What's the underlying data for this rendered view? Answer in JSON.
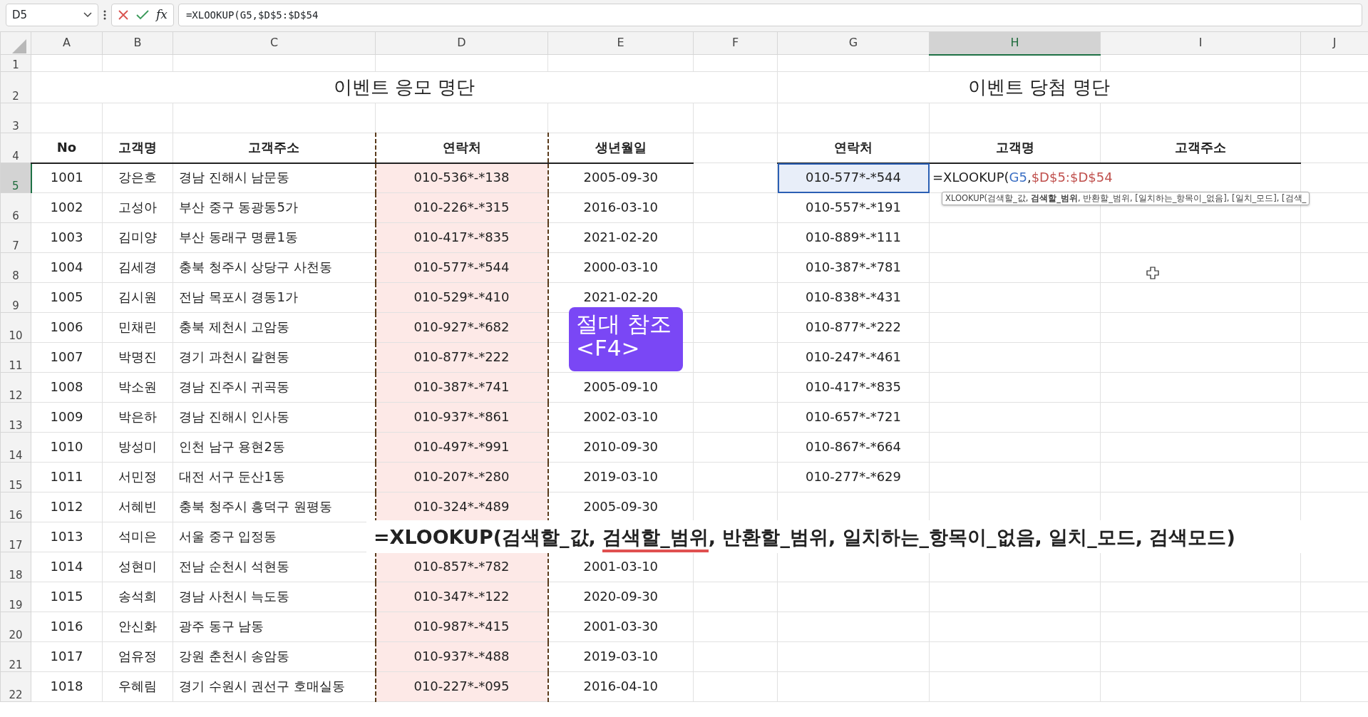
{
  "name_box": "D5",
  "formula_bar": {
    "fx_label": "fx",
    "formula": "=XLOOKUP(G5,$D$5:$D$54"
  },
  "columns": [
    {
      "label": "A",
      "selected": false
    },
    {
      "label": "B",
      "selected": false
    },
    {
      "label": "C",
      "selected": false
    },
    {
      "label": "D",
      "selected": false
    },
    {
      "label": "E",
      "selected": false
    },
    {
      "label": "F",
      "selected": false
    },
    {
      "label": "G",
      "selected": false
    },
    {
      "label": "H",
      "selected": true
    },
    {
      "label": "I",
      "selected": false
    },
    {
      "label": "J",
      "selected": false
    }
  ],
  "row_numbers": [
    {
      "label": "1",
      "selected": false
    },
    {
      "label": "2",
      "selected": false
    },
    {
      "label": "3",
      "selected": false
    },
    {
      "label": "4",
      "selected": false
    },
    {
      "label": "5",
      "selected": true
    },
    {
      "label": "6",
      "selected": false
    },
    {
      "label": "7",
      "selected": false
    },
    {
      "label": "8",
      "selected": false
    },
    {
      "label": "9",
      "selected": false
    },
    {
      "label": "10",
      "selected": false
    },
    {
      "label": "11",
      "selected": false
    },
    {
      "label": "12",
      "selected": false
    },
    {
      "label": "13",
      "selected": false
    },
    {
      "label": "14",
      "selected": false
    },
    {
      "label": "15",
      "selected": false
    },
    {
      "label": "16",
      "selected": false
    },
    {
      "label": "17",
      "selected": false
    },
    {
      "label": "18",
      "selected": false
    },
    {
      "label": "19",
      "selected": false
    },
    {
      "label": "20",
      "selected": false
    },
    {
      "label": "21",
      "selected": false
    },
    {
      "label": "22",
      "selected": false
    }
  ],
  "entry_list": {
    "title": "이벤트 응모 명단",
    "columns": [
      {
        "label": "No",
        "copied": false
      },
      {
        "label": "고객명",
        "copied": false
      },
      {
        "label": "고객주소",
        "copied": false
      },
      {
        "label": "연락처",
        "copied": true
      },
      {
        "label": "생년월일",
        "copied": false
      }
    ],
    "rows": [
      [
        "1001",
        "강은호",
        "경남 진해시 남문동",
        "010-536*-*138",
        "2005-09-30"
      ],
      [
        "1002",
        "고성아",
        "부산 중구 동광동5가",
        "010-226*-*315",
        "2016-03-10"
      ],
      [
        "1003",
        "김미양",
        "부산 동래구 명륜1동",
        "010-417*-*835",
        "2021-02-20"
      ],
      [
        "1004",
        "김세경",
        "충북 청주시 상당구 사천동",
        "010-577*-*544",
        "2000-03-10"
      ],
      [
        "1005",
        "김시원",
        "전남 목포시 경동1가",
        "010-529*-*410",
        "2021-02-20"
      ],
      [
        "1006",
        "민채린",
        "충북 제천시 고암동",
        "010-927*-*682"
      ],
      [
        "1007",
        "박명진",
        "경기 과천시 갈현동",
        "010-877*-*222"
      ],
      [
        "1008",
        "박소원",
        "경남 진주시 귀곡동",
        "010-387*-*741",
        "2005-09-10"
      ],
      [
        "1009",
        "박은하",
        "경남 진해시 인사동",
        "010-937*-*861",
        "2002-03-10"
      ],
      [
        "1010",
        "방성미",
        "인천 남구 용현2동",
        "010-497*-*991",
        "2010-09-30"
      ],
      [
        "1011",
        "서민정",
        "대전 서구 둔산1동",
        "010-207*-*280",
        "2019-03-10"
      ],
      [
        "1012",
        "서혜빈",
        "충북 청주시 흥덕구 원평동",
        "010-324*-*489",
        "2005-09-30"
      ],
      [
        "1013",
        "석미은",
        "서울 중구 입정동"
      ],
      [
        "1014",
        "성현미",
        "전남 순천시 석현동",
        "010-857*-*782",
        "2001-03-10"
      ],
      [
        "1015",
        "송석희",
        "경남 사천시 늑도동",
        "010-347*-*122",
        "2020-09-30"
      ],
      [
        "1016",
        "안신화",
        "광주 동구 남동",
        "010-987*-*415",
        "2001-03-30"
      ],
      [
        "1017",
        "엄유정",
        "강원 춘천시 송암동",
        "010-937*-*488",
        "2019-03-10"
      ],
      [
        "1018",
        "우혜림",
        "경기 수원시 권선구 호매실동",
        "010-227*-*095",
        "2016-04-10"
      ]
    ]
  },
  "winner_list": {
    "title": "이벤트 당첨 명단",
    "columns": [
      "연락처",
      "고객명",
      "고객주소"
    ],
    "rows": [
      {
        "phone": "010-577*-*544",
        "selected": true
      },
      {
        "phone": "010-557*-*191",
        "selected": false
      },
      {
        "phone": "010-889*-*111",
        "selected": false
      },
      {
        "phone": "010-387*-*781",
        "selected": false
      },
      {
        "phone": "010-838*-*431",
        "selected": false
      },
      {
        "phone": "010-877*-*222",
        "selected": false
      },
      {
        "phone": "010-247*-*461",
        "selected": false
      },
      {
        "phone": "010-417*-*835",
        "selected": false
      },
      {
        "phone": "010-657*-*721",
        "selected": false
      },
      {
        "phone": "010-867*-*664",
        "selected": false
      },
      {
        "phone": "010-277*-*629",
        "selected": false
      }
    ]
  },
  "editing_cell": {
    "parts": [
      {
        "text": "=XLOOKUP(",
        "color": "#222222"
      },
      {
        "text": "G5",
        "color": "#3b6fc4"
      },
      {
        "text": ",",
        "color": "#222222"
      },
      {
        "text": "$D$5:$D$54",
        "color": "#c0504d"
      }
    ]
  },
  "function_tooltip": "XLOOKUP(검색할_값, **검색할_범위**, 반환할_범위, [일치하는_항목이_없음], [일치_모드], [검색_",
  "shortcut_caption": [
    "절대 참조",
    "<F4>"
  ],
  "syntax_caption": [
    {
      "text": "=XLOOKUP(검색할_값, ",
      "underlined": false
    },
    {
      "text": "검색할_범위",
      "underlined": true
    },
    {
      "text": ", 반환할_범위, 일치하는_항목이_없음, 일치_모드, 검색모드)",
      "underlined": false
    }
  ]
}
